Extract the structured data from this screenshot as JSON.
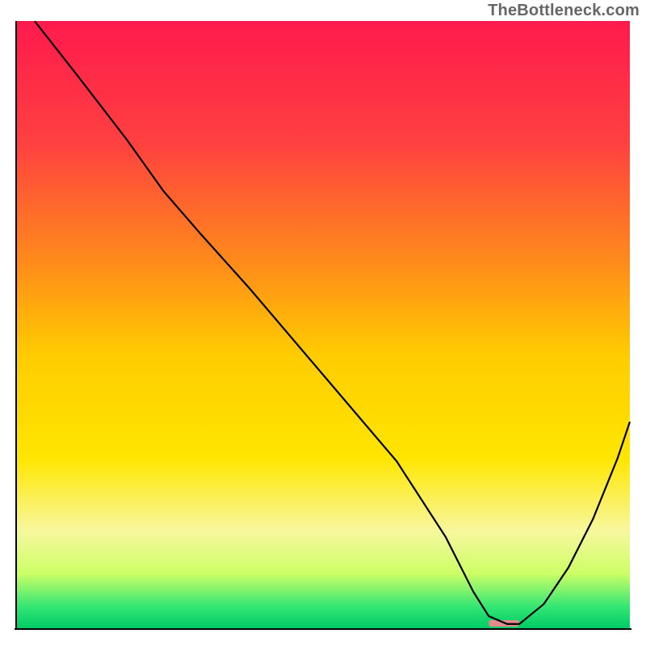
{
  "watermark": "TheBottleneck.com",
  "chart_data": {
    "type": "line",
    "title": "",
    "xlabel": "",
    "ylabel": "",
    "xlim": [
      0,
      100
    ],
    "ylim": [
      0,
      100
    ],
    "grid": false,
    "background_gradient": {
      "stops": [
        {
          "offset": 0,
          "color": "#ff1a4d"
        },
        {
          "offset": 0.2,
          "color": "#ff4040"
        },
        {
          "offset": 0.4,
          "color": "#ff8c1a"
        },
        {
          "offset": 0.55,
          "color": "#ffcc00"
        },
        {
          "offset": 0.72,
          "color": "#ffe600"
        },
        {
          "offset": 0.84,
          "color": "#f7f79e"
        },
        {
          "offset": 0.91,
          "color": "#ccff66"
        },
        {
          "offset": 0.965,
          "color": "#33e673"
        },
        {
          "offset": 1.0,
          "color": "#00cc66"
        }
      ]
    },
    "series": [
      {
        "name": "bottleneck-curve",
        "color": "#000000",
        "x": [
          3,
          10,
          18,
          24,
          30,
          38,
          46,
          54,
          62,
          70,
          74.5,
          77,
          80,
          82,
          86,
          90,
          94,
          98,
          100
        ],
        "y": [
          100,
          91,
          80.5,
          72,
          65,
          56,
          46.5,
          37,
          27.5,
          15,
          6,
          2,
          0.7,
          0.7,
          4,
          10,
          18,
          28,
          34
        ]
      }
    ],
    "marker": {
      "name": "optimal-range-marker",
      "x0": 77,
      "x1": 82,
      "y": 0.8,
      "color": "#e28b8b"
    },
    "axes_color": "#000000",
    "axes_width": 2
  }
}
